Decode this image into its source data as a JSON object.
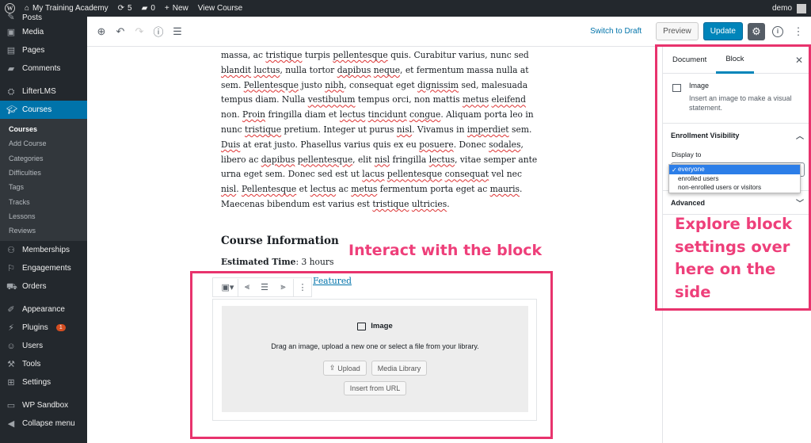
{
  "admin_bar": {
    "site_name": "My Training Academy",
    "updates_count": "5",
    "comments_count": "0",
    "new_label": "New",
    "view_course_label": "View Course",
    "user_label": "demo"
  },
  "sidebar": {
    "top_items": [
      {
        "label": "Posts",
        "icon": "pin-icon"
      },
      {
        "label": "Media",
        "icon": "media-icon"
      },
      {
        "label": "Pages",
        "icon": "pages-icon"
      },
      {
        "label": "Comments",
        "icon": "comments-icon"
      }
    ],
    "lifterlms": "LifterLMS",
    "courses": "Courses",
    "course_subitems": [
      "Courses",
      "Add Course",
      "Categories",
      "Difficulties",
      "Tags",
      "Tracks",
      "Lessons",
      "Reviews"
    ],
    "lower_items": [
      {
        "label": "Memberships"
      },
      {
        "label": "Engagements"
      },
      {
        "label": "Orders"
      }
    ],
    "appearance": "Appearance",
    "plugins": "Plugins",
    "plugins_badge": "1",
    "users": "Users",
    "tools": "Tools",
    "settings": "Settings",
    "wp_sandbox": "WP Sandbox",
    "collapse": "Collapse menu"
  },
  "toolbar": {
    "switch_to_draft": "Switch to Draft",
    "preview": "Preview",
    "update": "Update"
  },
  "content": {
    "paragraph_segments": [
      {
        "t": "massa, ac "
      },
      {
        "t": "tristique",
        "s": 1
      },
      {
        "t": " turpis "
      },
      {
        "t": "pellentesque",
        "s": 1
      },
      {
        "t": " quis. Curabitur varius, nunc sed "
      },
      {
        "t": "blandit",
        "s": 1
      },
      {
        "t": " "
      },
      {
        "t": "luctus",
        "s": 1
      },
      {
        "t": ", nulla tortor "
      },
      {
        "t": "dapibus",
        "s": 1
      },
      {
        "t": " "
      },
      {
        "t": "neque",
        "s": 1
      },
      {
        "t": ", et fermentum massa nulla at sem. "
      },
      {
        "t": "Pellentesque",
        "s": 1
      },
      {
        "t": " justo "
      },
      {
        "t": "nibh",
        "s": 1
      },
      {
        "t": ", consequat eget "
      },
      {
        "t": "dignissim",
        "s": 1
      },
      {
        "t": " sed, malesuada tempus diam. Nulla "
      },
      {
        "t": "vestibulum",
        "s": 1
      },
      {
        "t": " tempus orci, non mattis "
      },
      {
        "t": "metus",
        "s": 1
      },
      {
        "t": " "
      },
      {
        "t": "eleifend",
        "s": 1
      },
      {
        "t": " non. "
      },
      {
        "t": "Proin",
        "s": 1
      },
      {
        "t": " fringilla diam et "
      },
      {
        "t": "lectus",
        "s": 1
      },
      {
        "t": " "
      },
      {
        "t": "tincidunt",
        "s": 1
      },
      {
        "t": " "
      },
      {
        "t": "congue",
        "s": 1
      },
      {
        "t": ". Aliquam porta leo in nunc "
      },
      {
        "t": "tristique",
        "s": 1
      },
      {
        "t": " pretium. Integer ut purus "
      },
      {
        "t": "nisl",
        "s": 1
      },
      {
        "t": ". Vivamus in "
      },
      {
        "t": "imperdiet",
        "s": 1
      },
      {
        "t": " sem. "
      },
      {
        "t": "Duis",
        "s": 1
      },
      {
        "t": " at erat justo. Phasellus varius quis ex eu "
      },
      {
        "t": "posuere",
        "s": 1
      },
      {
        "t": ". Donec "
      },
      {
        "t": "sodales",
        "s": 1
      },
      {
        "t": ", libero ac "
      },
      {
        "t": "dapibus",
        "s": 1
      },
      {
        "t": " "
      },
      {
        "t": "pellentesque",
        "s": 1
      },
      {
        "t": ", elit "
      },
      {
        "t": "nisl",
        "s": 1
      },
      {
        "t": " fringilla "
      },
      {
        "t": "lectus",
        "s": 1
      },
      {
        "t": ", vitae semper ante urna eget sem. Donec sed est ut "
      },
      {
        "t": "lacus",
        "s": 1
      },
      {
        "t": " "
      },
      {
        "t": "pellentesque",
        "s": 1
      },
      {
        "t": " "
      },
      {
        "t": "consequat",
        "s": 1
      },
      {
        "t": " vel nec "
      },
      {
        "t": "nisl",
        "s": 1
      },
      {
        "t": ". "
      },
      {
        "t": "Pellentesque",
        "s": 1
      },
      {
        "t": " et "
      },
      {
        "t": "lectus",
        "s": 1
      },
      {
        "t": " ac "
      },
      {
        "t": "metus",
        "s": 1
      },
      {
        "t": " fermentum porta eget ac "
      },
      {
        "t": "mauris",
        "s": 1
      },
      {
        "t": ". Maecenas bibendum est varius est "
      },
      {
        "t": "tristique",
        "s": 1
      },
      {
        "t": " "
      },
      {
        "t": "ultricies",
        "s": 1
      },
      {
        "t": "."
      }
    ],
    "heading": "Course Information",
    "estimated_time_label": "Estimated Time",
    "estimated_time_value": ": 3 hours",
    "featured_link": "Featured"
  },
  "image_block": {
    "title": "Image",
    "instructions": "Drag an image, upload a new one or select a file from your library.",
    "upload": "Upload",
    "media_library": "Media Library",
    "insert_from_url": "Insert from URL"
  },
  "panel": {
    "tab_document": "Document",
    "tab_block": "Block",
    "block_title": "Image",
    "block_desc": "Insert an image to make a visual statement.",
    "enrollment_visibility": "Enrollment Visibility",
    "display_to": "Display to",
    "options": [
      "everyone",
      "enrolled users",
      "non-enrolled users or visitors"
    ],
    "selected_option": "everyone",
    "advanced": "Advanced"
  },
  "annotations": {
    "left": "Interact with the block",
    "right": "Explore block settings over here on the side"
  },
  "colors": {
    "accent": "#0085ba",
    "annotation": "#ee3f7a",
    "sidebar_bg": "#23282d",
    "active_menu": "#0073aa"
  }
}
